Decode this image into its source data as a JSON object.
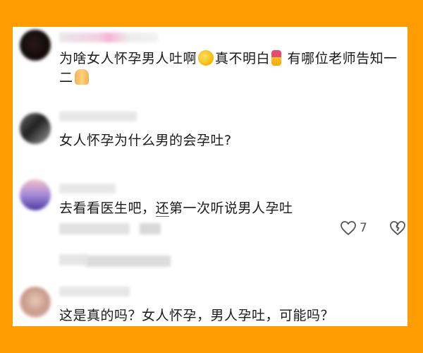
{
  "comments": [
    {
      "text_1": "为啥女人怀孕男人吐啊",
      "emoji_1": "laughing-face-icon",
      "text_2": "真不明白",
      "emoji_2": "medal-icon",
      "text_3": "有哪位老师告知一二",
      "emoji_3": "praying-hands-icon"
    },
    {
      "text": "女人怀孕为什么男的会孕吐?"
    },
    {
      "text_prefix": "去看看医生吧，",
      "text_mention": "还",
      "text_suffix": "第一次听说男人孕吐",
      "like_count": "7"
    },
    {
      "text": "这是真的吗？女人怀孕，男人孕吐，可能吗？"
    }
  ],
  "colors": {
    "frame": "#ff9c00",
    "card": "#ffffff",
    "text": "#1a1a1a"
  }
}
